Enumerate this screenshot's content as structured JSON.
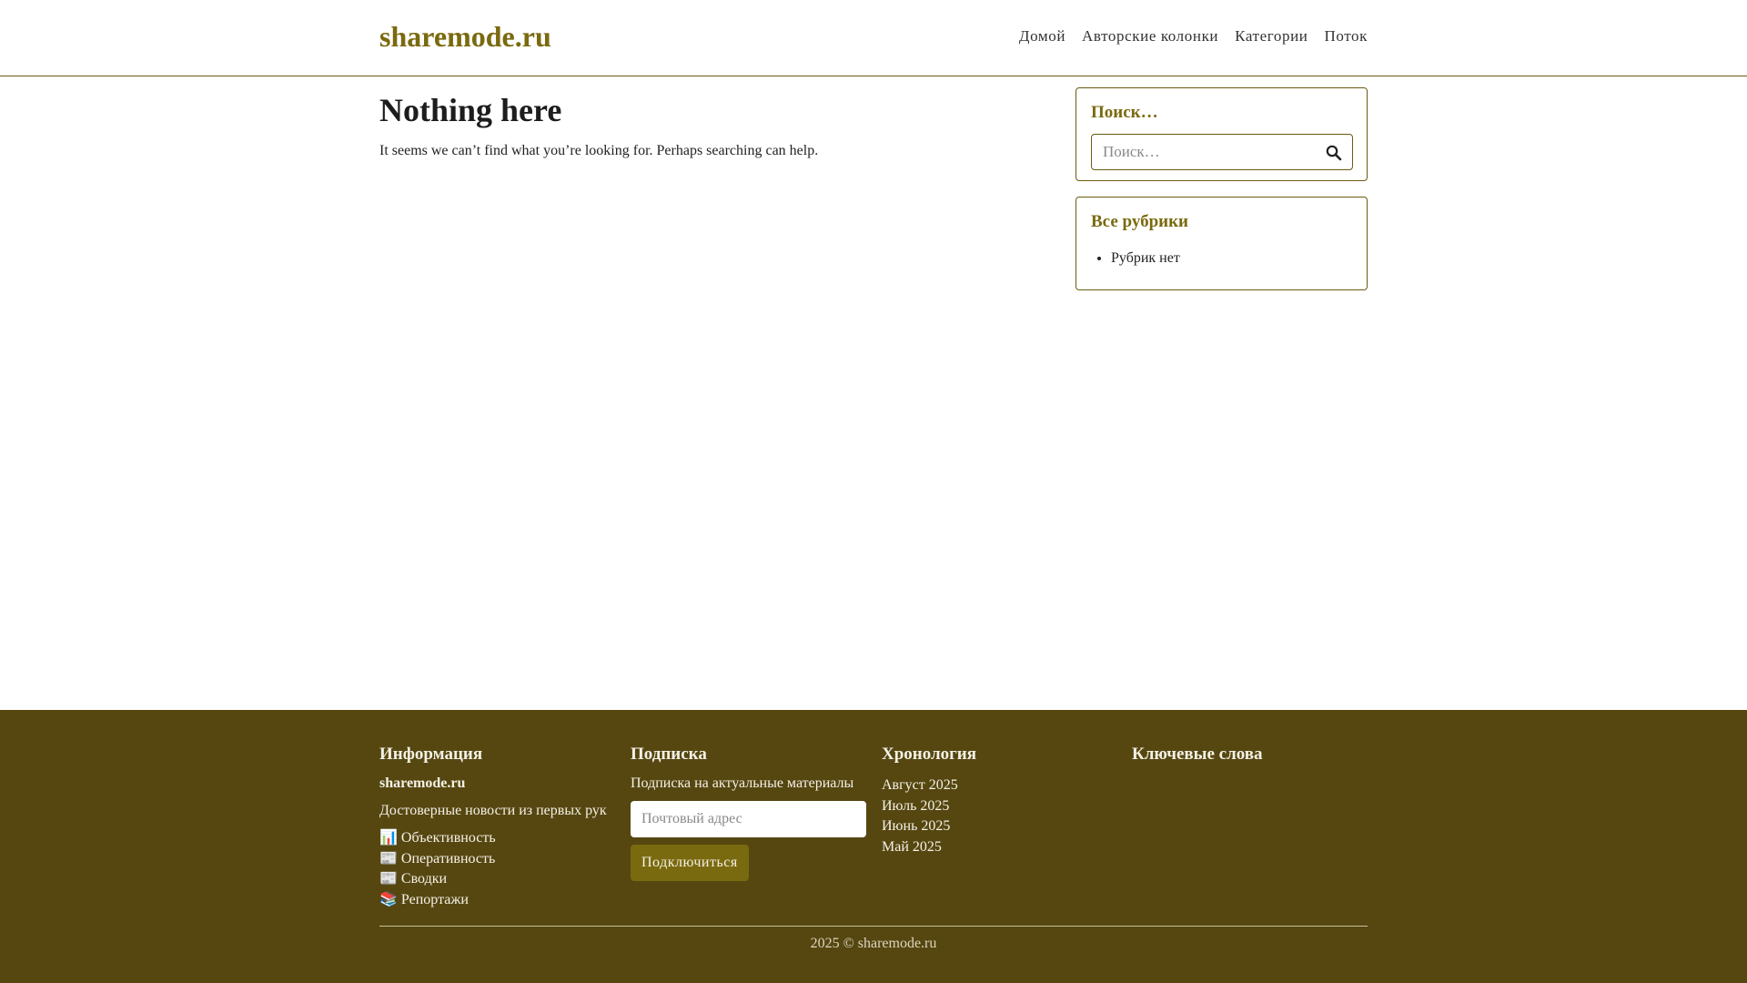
{
  "header": {
    "brand": "sharemode.ru",
    "nav": [
      "Домой",
      "Авторские колонки",
      "Категории",
      "Поток"
    ]
  },
  "main": {
    "title": "Nothing here",
    "text": "It seems we can’t find what you’re looking for. Perhaps searching can help."
  },
  "sidebar": {
    "search": {
      "title": "Поиск…",
      "placeholder": "Поиск…"
    },
    "categories": {
      "title": "Все рубрики",
      "items": [
        "Рубрик нет"
      ]
    }
  },
  "footer": {
    "info": {
      "title": "Информация",
      "site": "sharemode.ru",
      "description": "Достоверные новости из первых рук",
      "links": [
        "📊 Объективность",
        "📰 Оперативность",
        "📰 Сводки",
        "📚 Репортажи"
      ]
    },
    "subscribe": {
      "title": "Подписка",
      "description": "Подписка на актуальные материалы",
      "placeholder": "Почтовый адрес",
      "button": "Подключиться"
    },
    "archive": {
      "title": "Хронология",
      "items": [
        "Август 2025",
        "Июль 2025",
        "Июнь 2025",
        "Май 2025"
      ]
    },
    "tags": {
      "title": "Ключевые слова"
    },
    "copyright": "2025 © sharemode.ru"
  },
  "colors": {
    "brand": "#7a6a0f",
    "footer_bg": "#564711",
    "border": "#6b5b11"
  }
}
